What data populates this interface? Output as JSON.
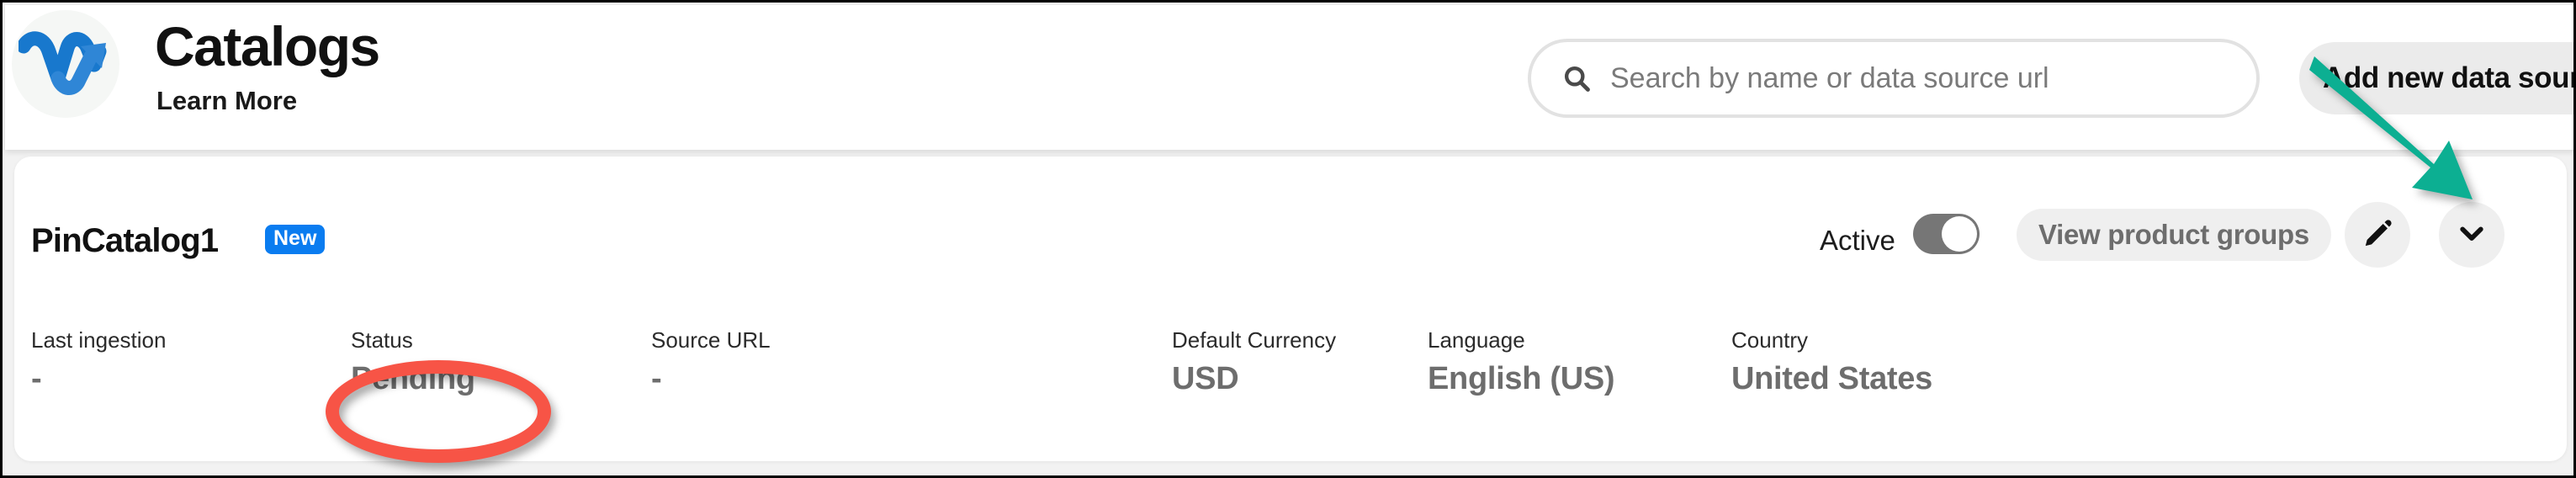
{
  "header": {
    "logo_icon": "webmotive-w-arrow-logo",
    "title": "Catalogs",
    "learn_more": "Learn More",
    "search": {
      "icon": "search-icon",
      "placeholder": "Search by name or data source url",
      "value": ""
    },
    "add_data_source_label": "Add new data source"
  },
  "catalog": {
    "name": "PinCatalog1",
    "badge": "New",
    "active_label": "Active",
    "active_state": true,
    "view_product_groups_label": "View product groups",
    "edit_icon": "pencil-icon",
    "expand_icon": "chevron-down-icon",
    "columns": [
      {
        "header": "Last ingestion",
        "value": "-"
      },
      {
        "header": "Status",
        "value": "Pending"
      },
      {
        "header": "Source URL",
        "value": "-"
      },
      {
        "header": "Default Currency",
        "value": "USD"
      },
      {
        "header": "Language",
        "value": "English (US)"
      },
      {
        "header": "Country",
        "value": "United States"
      }
    ]
  },
  "annotations": {
    "ellipse_color": "#F75446",
    "arrow_color": "#0CAF92",
    "ellipse_target": "Pending",
    "arrow_target": "chevron-down-icon"
  },
  "colors": {
    "accent_blue": "#0A7CF0",
    "page_background": "#F2F2F2",
    "card_background": "#FFFFFF",
    "pill_background": "#EFEFEF",
    "toggle_on": "#767676"
  }
}
